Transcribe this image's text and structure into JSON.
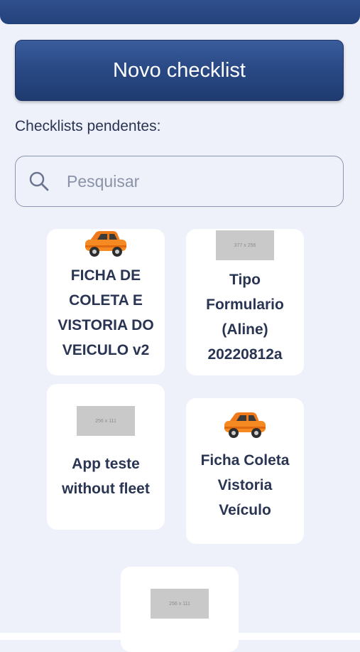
{
  "new_checklist_label": "Novo checklist",
  "section_label": "Checklists pendentes:",
  "search": {
    "placeholder": "Pesquisar",
    "value": ""
  },
  "cards": [
    {
      "title": "FICHA DE\nCOLETA E\nVISTORIA DO\nVEICULO v2",
      "image": "car-icon"
    },
    {
      "title": "Tipo\nFormulario\n(Aline)\n20220812a",
      "image": "placeholder-image",
      "placeholder_text": "377 x 256"
    },
    {
      "title": "App teste\nwithout fleet",
      "image": "placeholder-image",
      "placeholder_text": "256 x 111"
    },
    {
      "title": "Ficha Coleta\nVistoria\nVeículo",
      "image": "car-icon"
    },
    {
      "title": "",
      "image": "placeholder-image",
      "placeholder_text": "256 x 111"
    }
  ],
  "colors": {
    "header": "#24427c",
    "accent": "#2a4a86",
    "background": "#eef1f9",
    "text": "#2a3553",
    "car": "#f07a1a"
  }
}
